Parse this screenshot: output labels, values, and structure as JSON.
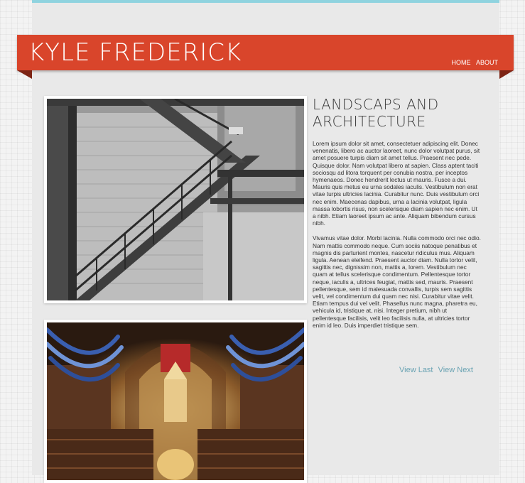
{
  "site": {
    "title": "Kyle Frederick"
  },
  "nav": {
    "items": [
      "HOME",
      "ABOUT"
    ]
  },
  "article": {
    "title": "Landscaps and Architecture",
    "paragraphs": [
      "Lorem ipsum dolor sit amet, consectetuer adipiscing elit. Donec venenatis, libero ac auctor laoreet, nunc dolor volutpat purus, sit amet posuere turpis diam sit amet tellus. Praesent nec pede. Quisque dolor. Nam volutpat libero at sapien. Class aptent taciti sociosqu ad litora torquent per conubia nostra, per inceptos hymenaeos. Donec hendrerit lectus ut mauris. Fusce a dui. Mauris quis metus eu urna sodales iaculis. Vestibulum non erat vitae turpis ultricies lacinia. Curabitur nunc. Duis vestibulum orci nec enim. Maecenas dapibus, urna a lacinia volutpat, ligula massa lobortis risus, non scelerisque diam sapien nec enim. Ut a nibh. Etiam laoreet ipsum ac ante. Aliquam bibendum cursus nibh.",
      "Vivamus vitae dolor. Morbi lacinia. Nulla commodo orci nec odio. Nam mattis commodo neque. Cum sociis natoque penatibus et magnis dis parturient montes, nascetur ridiculus mus. Aliquam ligula. Aenean eleifend. Praesent auctor diam. Nulla tortor velit, sagittis nec, dignissim non, mattis a, lorem. Vestibulum nec quam at tellus scelerisque condimentum. Pellentesque tortor neque, iaculis a, ultrices feugiat, mattis sed, mauris. Praesent pellentesque, sem id malesuada convallis, turpis sem sagittis velit, vel condimentum dui quam nec nisi. Curabitur vitae velit. Etiam tempus dui vel velit. Phasellus nunc magna, pharetra eu, vehicula id, tristique at, nisi. Integer pretium, nibh ut pellentesque facilisis, velit leo facilisis nulla, at ultricies tortor enim id leo. Duis imperdiet tristique sem."
    ]
  },
  "pager": {
    "prev": "View Last",
    "next": "View Next"
  },
  "colors": {
    "banner": "#d9452b",
    "accent": "#8fd3df",
    "link": "#6aa3b3"
  }
}
